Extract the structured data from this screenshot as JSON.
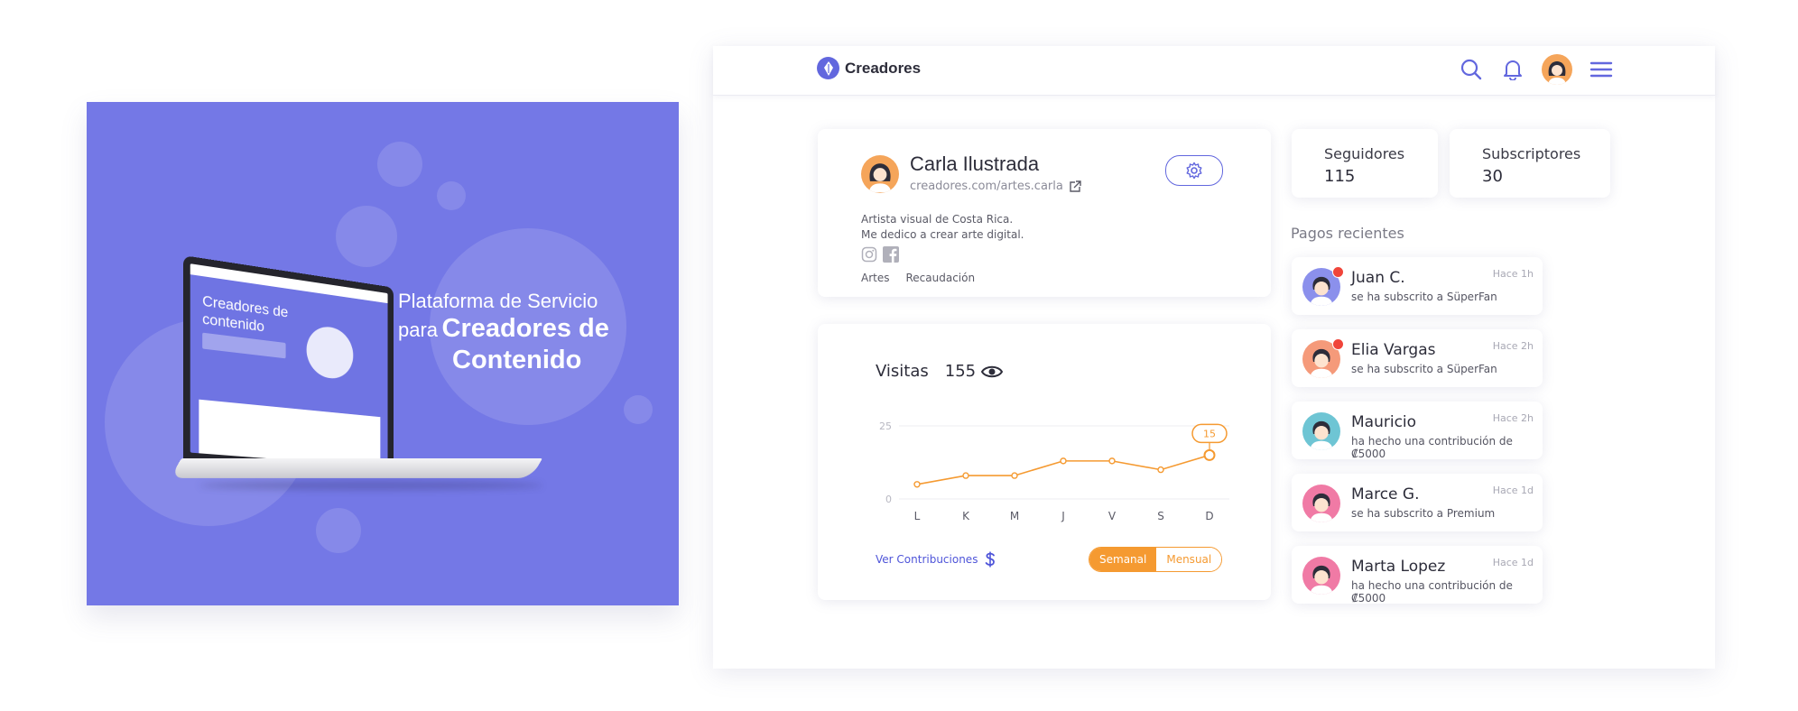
{
  "promo": {
    "title_line1": "Plataforma de Servicio",
    "title_line2_prefix": "para",
    "title_line2_big": "Creadores de",
    "title_line3": "Contenido",
    "laptop_screen_title": "Creadores de contenido"
  },
  "app": {
    "brand": "Creadores",
    "top_icons": [
      "search-icon",
      "bell-icon",
      "avatar",
      "menu-icon"
    ],
    "accent": "#6267de",
    "orange": "#f59a31"
  },
  "profile": {
    "name": "Carla Ilustrada",
    "url": "creadores.com/artes.carla",
    "bio_line1": "Artista visual de Costa Rica.",
    "bio_line2": "Me dedico a crear arte digital.",
    "links": [
      "Artes",
      "Recaudación"
    ]
  },
  "stats": {
    "followers_label": "Seguidores",
    "followers_value": "115",
    "subscribers_label": "Subscriptores",
    "subscribers_value": "30"
  },
  "visits": {
    "label": "Visitas",
    "count": "155",
    "contrib_link": "Ver Contribuciones",
    "toggle_weekly": "Semanal",
    "toggle_monthly": "Mensual"
  },
  "chart_data": {
    "type": "line",
    "categories": [
      "L",
      "K",
      "M",
      "J",
      "V",
      "S",
      "D"
    ],
    "values": [
      5,
      8,
      8,
      13,
      13,
      10,
      15
    ],
    "yticks": [
      "25",
      "0"
    ],
    "ylim": [
      0,
      25
    ],
    "highlight_label": "15",
    "color": "#f59a31"
  },
  "payments": {
    "title": "Pagos recientes",
    "items": [
      {
        "name": "Juan C.",
        "desc": "se ha subscrito a SüperFan",
        "time": "Hace 1h",
        "unread": true,
        "bg": "#8b90ec"
      },
      {
        "name": "Elia Vargas",
        "desc": "se ha subscrito a SüperFan",
        "time": "Hace 2h",
        "unread": true,
        "bg": "#f59a7a"
      },
      {
        "name": "Mauricio",
        "desc": "ha hecho una contribución de ₡5000",
        "time": "Hace 2h",
        "unread": false,
        "bg": "#6ec5d4"
      },
      {
        "name": "Marce G.",
        "desc": "se ha subscrito a Premium",
        "time": "Hace 1d",
        "unread": false,
        "bg": "#f07aa5"
      },
      {
        "name": "Marta Lopez",
        "desc": "ha hecho una contribución de ₡5000",
        "time": "Hace 1d",
        "unread": false,
        "bg": "#f07aa5"
      }
    ]
  }
}
